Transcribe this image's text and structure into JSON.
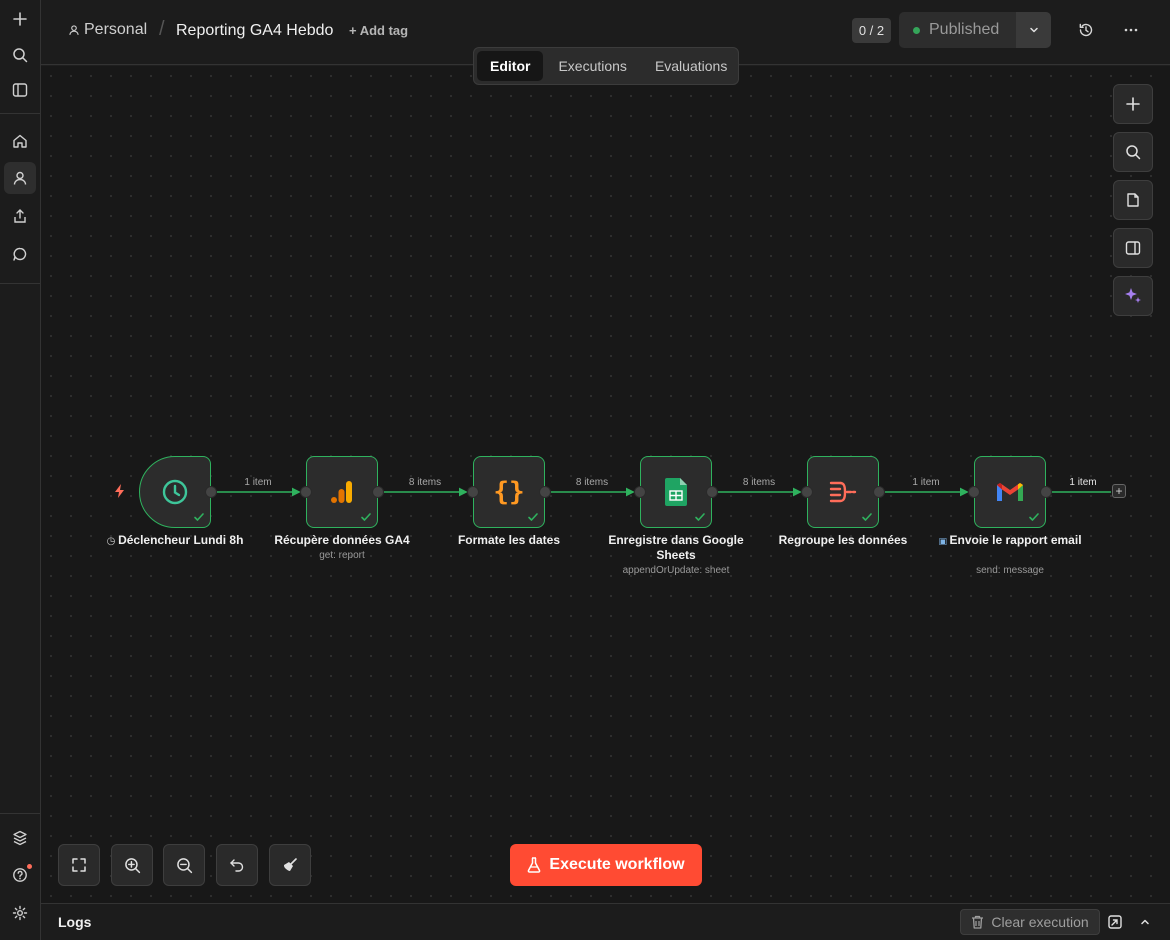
{
  "header": {
    "project": "Personal",
    "workflow_title": "Reporting GA4 Hebdo",
    "add_tag": "+ Add tag",
    "version_counter": "0 / 2",
    "publish_status": "Published"
  },
  "tabs": [
    {
      "label": "Editor",
      "active": true
    },
    {
      "label": "Executions",
      "active": false
    },
    {
      "label": "Evaluations",
      "active": false
    }
  ],
  "nodes": [
    {
      "label": "Déclencheur Lundi 8h",
      "subtitle": "",
      "icon": "clock-icon",
      "status": "success"
    },
    {
      "label": "Récupère données GA4",
      "subtitle": "get: report",
      "icon": "google-analytics-icon",
      "status": "success"
    },
    {
      "label": "Formate les dates",
      "subtitle": "",
      "icon": "code-braces-icon",
      "status": "success"
    },
    {
      "label": "Enregistre dans Google Sheets",
      "subtitle": "appendOrUpdate: sheet",
      "icon": "google-sheets-icon",
      "status": "success"
    },
    {
      "label": "Regroupe les données",
      "subtitle": "",
      "icon": "aggregate-icon",
      "status": "success"
    },
    {
      "label": "Envoie le rapport email",
      "subtitle": "send: message",
      "icon": "gmail-icon",
      "status": "success"
    }
  ],
  "connections": [
    {
      "label": "1 item"
    },
    {
      "label": "8 items"
    },
    {
      "label": "8 items"
    },
    {
      "label": "8 items"
    },
    {
      "label": "1 item"
    },
    {
      "label": "1 item"
    }
  ],
  "canvas_controls": {
    "execute_label": "Execute workflow"
  },
  "logs": {
    "title": "Logs",
    "clear_label": "Clear execution"
  },
  "colors": {
    "success": "#2fb25e",
    "accent": "#ff4b33",
    "canvas": "#181818"
  }
}
